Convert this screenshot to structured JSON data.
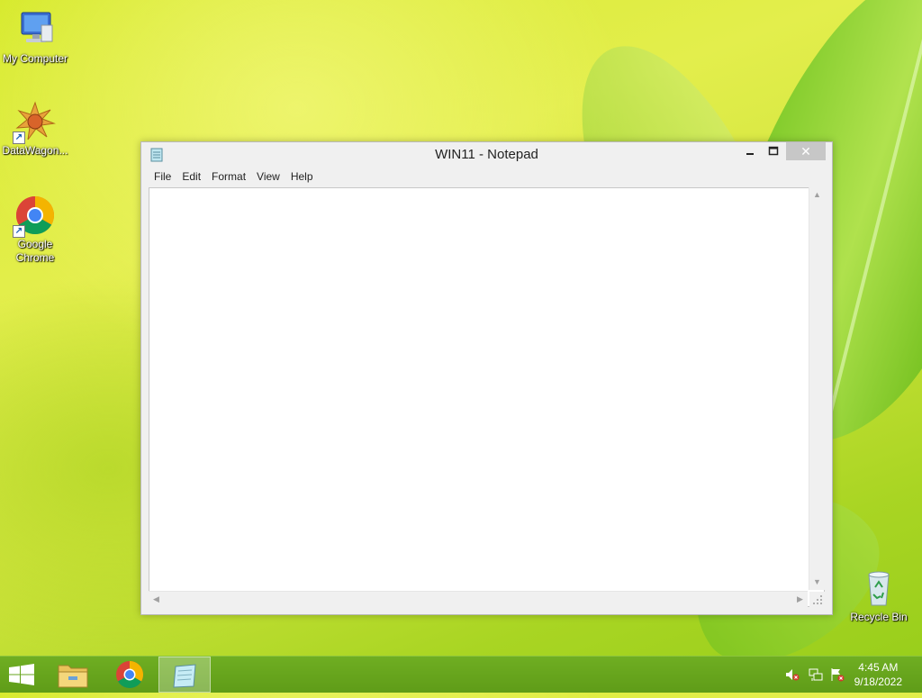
{
  "desktop": {
    "icons": [
      {
        "label": "My Computer"
      },
      {
        "label": "DataWagon..."
      },
      {
        "label_line1": "Google",
        "label_line2": "Chrome"
      },
      {
        "label": "Recycle Bin"
      }
    ]
  },
  "window": {
    "title": "WIN11 - Notepad",
    "controls": {
      "minimize": "–",
      "maximize": "□",
      "close": "✕"
    },
    "menu": [
      "File",
      "Edit",
      "Format",
      "View",
      "Help"
    ],
    "content": ""
  },
  "taskbar": {
    "apps": [
      "start-button",
      "file-explorer",
      "google-chrome",
      "notepad"
    ],
    "active_app": "notepad"
  },
  "tray": {
    "icons": [
      "volume-muted-icon",
      "network-icon",
      "action-center-flag-icon"
    ],
    "time": "4:45 AM",
    "date": "9/18/2022"
  },
  "colors": {
    "taskbar": "#66a51d",
    "accent_wallpaper": "#d7ea2e",
    "close_button": "#c7c7c7"
  }
}
